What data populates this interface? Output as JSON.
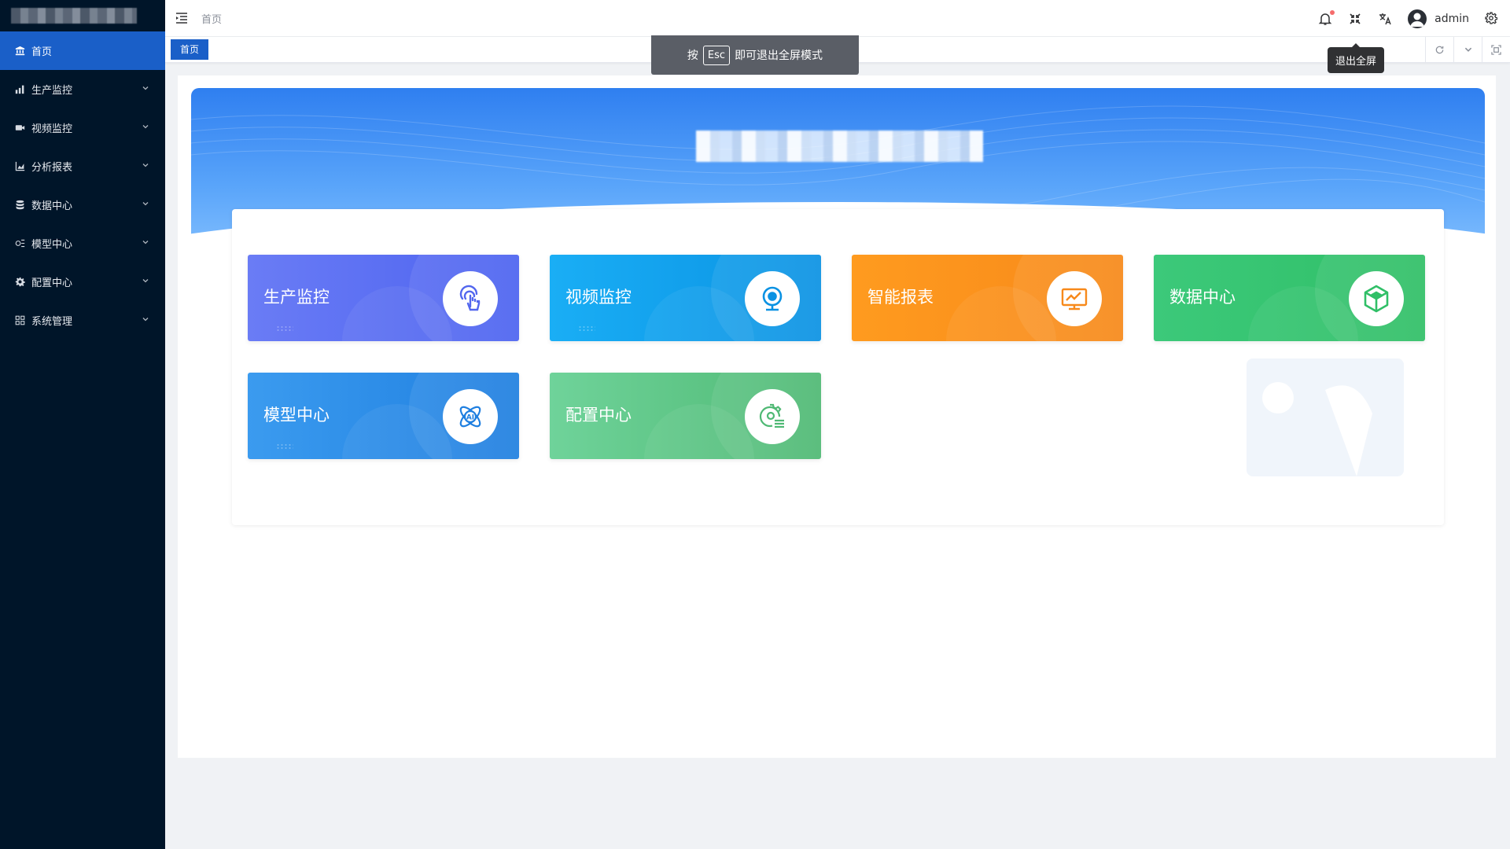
{
  "sidebar": {
    "items": [
      {
        "label": "首页",
        "icon": "bank-icon"
      },
      {
        "label": "生产监控",
        "icon": "bar-chart-icon"
      },
      {
        "label": "视频监控",
        "icon": "video-camera-icon"
      },
      {
        "label": "分析报表",
        "icon": "area-chart-icon"
      },
      {
        "label": "数据中心",
        "icon": "database-icon"
      },
      {
        "label": "模型中心",
        "icon": "model-icon"
      },
      {
        "label": "配置中心",
        "icon": "gear-icon"
      },
      {
        "label": "系统管理",
        "icon": "grid-icon"
      }
    ]
  },
  "header": {
    "breadcrumb": "首页",
    "username": "admin"
  },
  "tags": {
    "active": "首页"
  },
  "fullscreen": {
    "press": "按",
    "key": "Esc",
    "message": "即可退出全屏模式",
    "tooltip": "退出全屏"
  },
  "tiles": [
    {
      "label": "生产监控",
      "icon": "hand-touch-icon",
      "color": "#4d63f0"
    },
    {
      "label": "视频监控",
      "icon": "webcam-icon",
      "color": "#0a92e3"
    },
    {
      "label": "智能报表",
      "icon": "monitor-chart-icon",
      "color": "#f7891a"
    },
    {
      "label": "数据中心",
      "icon": "cube-icon",
      "color": "#30bf67"
    },
    {
      "label": "模型中心",
      "icon": "ai-atom-icon",
      "color": "#1f7fe0"
    },
    {
      "label": "配置中心",
      "icon": "gear-list-icon",
      "color": "#4fb974"
    }
  ],
  "colors": {
    "sidebar_bg": "#001529",
    "accent": "#1a5fc8"
  }
}
